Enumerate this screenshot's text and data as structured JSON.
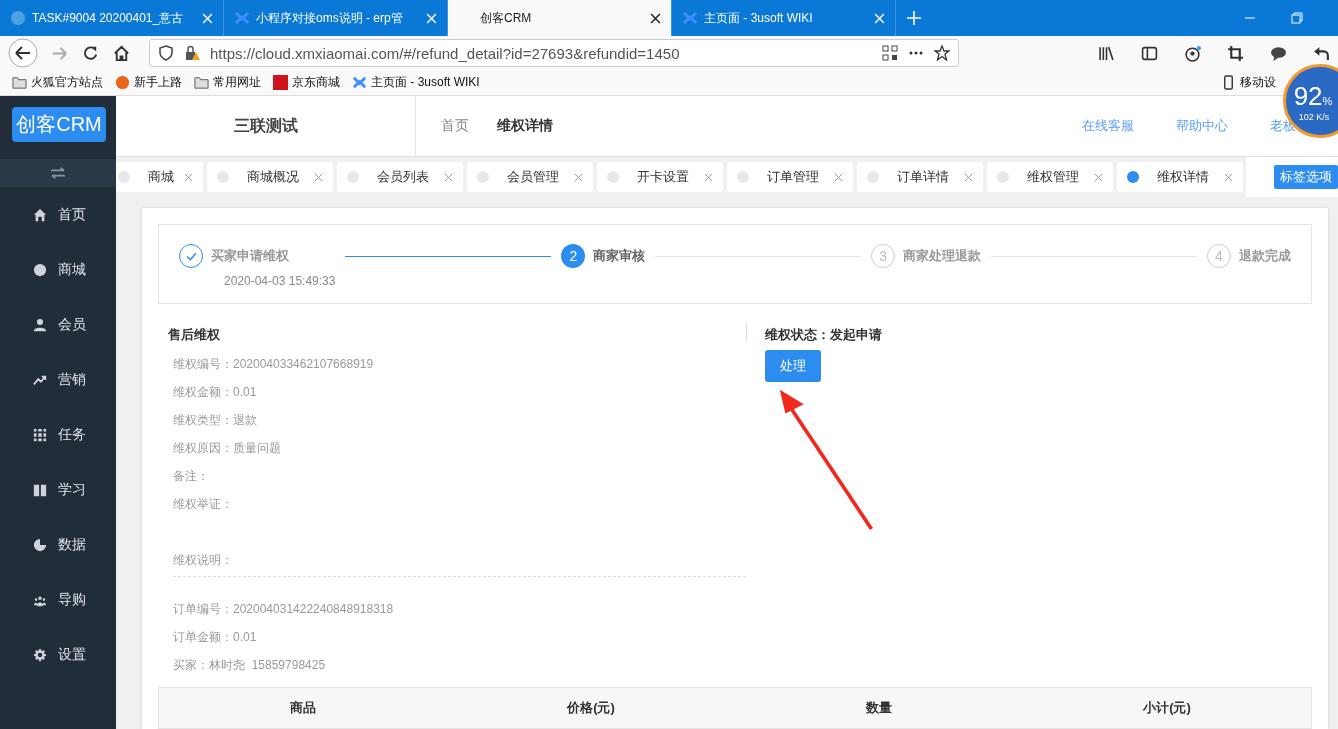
{
  "browser": {
    "tabs": [
      {
        "title": "TASK#9004 20200401_意古",
        "selected": false
      },
      {
        "title": "小程序对接oms说明 - erp管",
        "selected": false
      },
      {
        "title": "创客CRM",
        "selected": true
      },
      {
        "title": "主页面 - 3usoft WIKI",
        "selected": false
      }
    ],
    "url": "https://cloud.xmxiaomai.com/#/refund_detail?id=27693&refundid=1450",
    "bookmarks": [
      "火狐官方站点",
      "新手上路",
      "常用网址",
      "京东商城",
      "主页面 - 3usoft WIKI"
    ],
    "mobile_bookmark": "移动设",
    "speed_widget": {
      "percent": "92",
      "unit": "%",
      "rate": "102 K/s"
    }
  },
  "app": {
    "logo": "创客CRM",
    "sidebar": [
      "首页",
      "商城",
      "会员",
      "营销",
      "任务",
      "学习",
      "数据",
      "导购",
      "设置"
    ],
    "shop_name": "三联测试",
    "breadcrumb": [
      "首页",
      "维权详情"
    ],
    "header_links": [
      "在线客服",
      "帮助中心",
      "老板"
    ],
    "page_tabs": [
      {
        "label": "商城",
        "selected": false
      },
      {
        "label": "商城概况",
        "selected": false
      },
      {
        "label": "会员列表",
        "selected": false
      },
      {
        "label": "会员管理",
        "selected": false
      },
      {
        "label": "开卡设置",
        "selected": false
      },
      {
        "label": "订单管理",
        "selected": false
      },
      {
        "label": "订单详情",
        "selected": false
      },
      {
        "label": "维权管理",
        "selected": false
      },
      {
        "label": "维权详情",
        "selected": true
      }
    ],
    "tab_options": "标签选项",
    "steps": [
      {
        "title": "买家申请维权",
        "time": "2020-04-03 15:49:33",
        "kind": "done"
      },
      {
        "number": "2",
        "title": "商家审核",
        "kind": "active"
      },
      {
        "number": "3",
        "title": "商家处理退款",
        "kind": "wait"
      },
      {
        "number": "4",
        "title": "退款完成",
        "kind": "wait"
      }
    ],
    "section_title": "售后维权",
    "fields": [
      {
        "label": "维权编号：",
        "value": "202004033462107668919"
      },
      {
        "label": "维权金额：",
        "value": "0.01"
      },
      {
        "label": "维权类型：",
        "value": "退款"
      },
      {
        "label": "维权原因：",
        "value": "质量问题"
      },
      {
        "label": "备注："
      },
      {
        "label": "维权举证："
      }
    ],
    "explanation_label": "维权说明：",
    "order_fields": [
      {
        "label": "订单编号：",
        "value": "202004031422240848918318"
      },
      {
        "label": "订单金额：",
        "value": "0.01"
      },
      {
        "label": "买家：",
        "value": "林时尧  15859798425"
      }
    ],
    "status": "维权状态：发起申请",
    "process_button": "处理",
    "table_columns": [
      "商品",
      "价格(元)",
      "数量",
      "小计(元)"
    ]
  }
}
